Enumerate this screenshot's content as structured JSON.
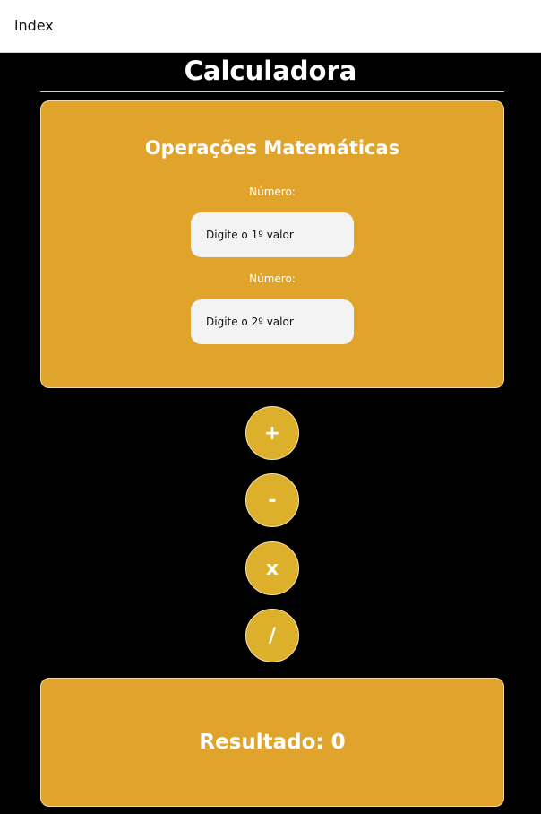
{
  "window": {
    "title": "index"
  },
  "page": {
    "heading": "Calculadora"
  },
  "operations_panel": {
    "title": "Operações Matemáticas",
    "field1": {
      "label": "Número:",
      "value": "",
      "placeholder": "Digite o 1º valor"
    },
    "field2": {
      "label": "Número:",
      "value": "",
      "placeholder": "Digite o 2º valor"
    }
  },
  "buttons": {
    "add": "+",
    "subtract": "-",
    "multiply": "x",
    "divide": "/"
  },
  "result": {
    "text": "Resultado: 0"
  },
  "colors": {
    "page_background": "#000000",
    "panel_background": "#e0a42c",
    "button_background": "#ddb02c",
    "input_background": "#f3f3f3",
    "text_light": "#ffffff"
  }
}
